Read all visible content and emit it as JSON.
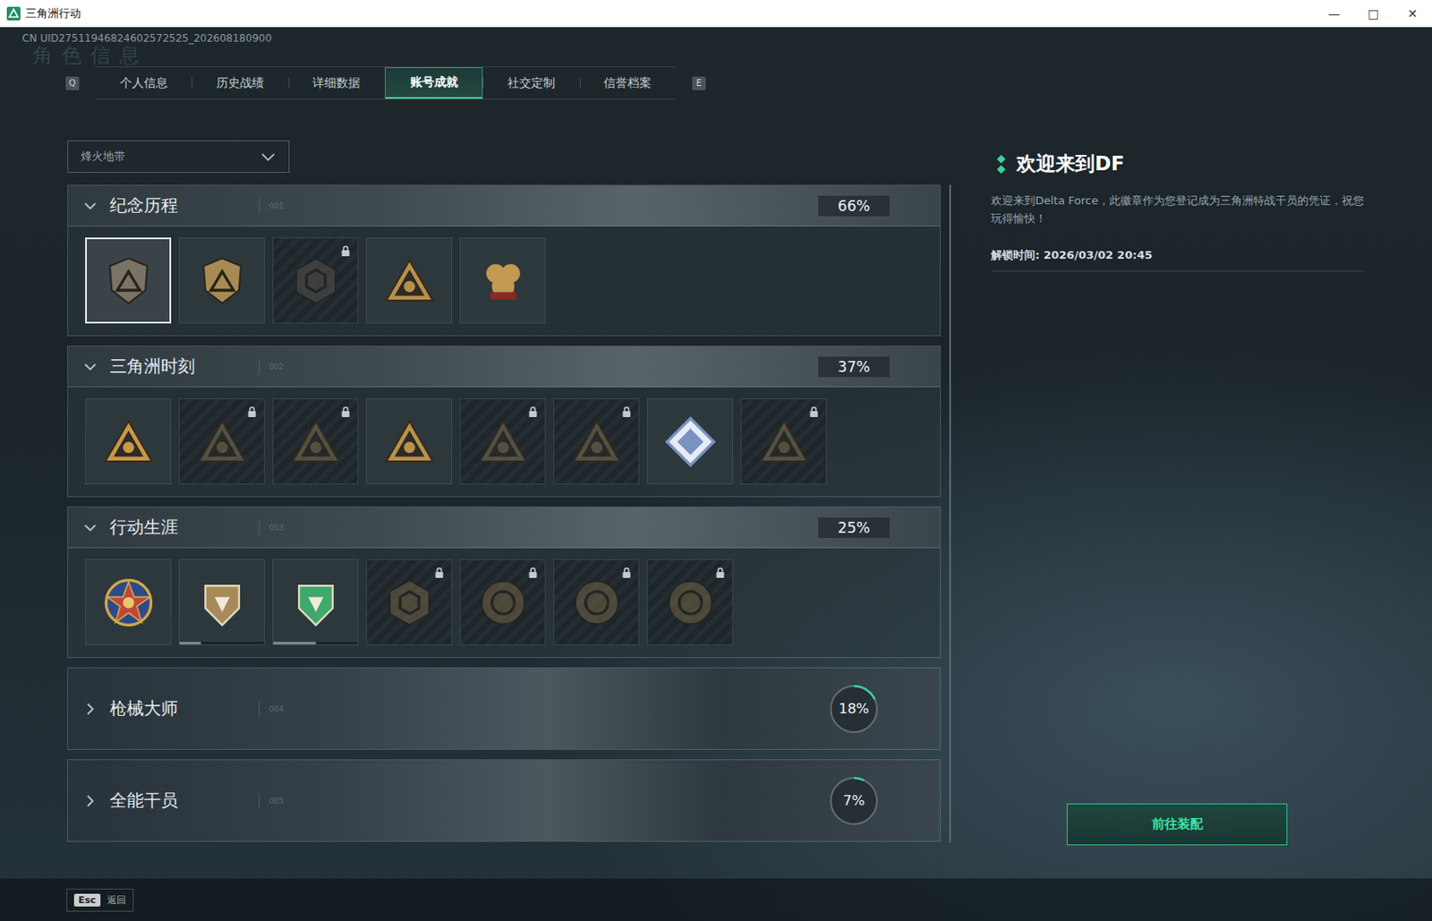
{
  "window": {
    "title": "三角洲行动",
    "controls": [
      "—",
      "□",
      "✕"
    ]
  },
  "uid": "CN UID27511946824602572525_202608180900",
  "watermark": "角色信息",
  "tabs": {
    "prevKey": "Q",
    "nextKey": "E",
    "items": [
      {
        "label": "个人信息",
        "selected": false
      },
      {
        "label": "历史战绩",
        "selected": false
      },
      {
        "label": "详细数据",
        "selected": false
      },
      {
        "label": "账号成就",
        "selected": true
      },
      {
        "label": "社交定制",
        "selected": false
      },
      {
        "label": "信誉档案",
        "selected": false
      }
    ]
  },
  "modeSelect": {
    "value": "烽火地带"
  },
  "categories": [
    {
      "index": "001",
      "title": "纪念历程",
      "progress": "66%",
      "expanded": true,
      "badges": [
        {
          "kind": "shield",
          "color": "#7a7466",
          "locked": false,
          "selected": true
        },
        {
          "kind": "shield",
          "color": "#a98a52",
          "locked": false,
          "selected": false
        },
        {
          "kind": "hexagon",
          "color": "#5a5650",
          "locked": true,
          "selected": false
        },
        {
          "kind": "triangle",
          "color": "#b8904e",
          "locked": false,
          "selected": false
        },
        {
          "kind": "cluster",
          "color": "#c29a52",
          "locked": false,
          "selected": false
        }
      ]
    },
    {
      "index": "002",
      "title": "三角洲时刻",
      "progress": "37%",
      "expanded": true,
      "badges": [
        {
          "kind": "triangle",
          "color": "#c79a4a",
          "locked": false,
          "selected": false
        },
        {
          "kind": "triangle",
          "color": "#8a7850",
          "locked": true,
          "selected": false
        },
        {
          "kind": "triangle",
          "color": "#8a7850",
          "locked": true,
          "selected": false
        },
        {
          "kind": "triangle",
          "color": "#b8924e",
          "locked": false,
          "selected": false
        },
        {
          "kind": "triangle",
          "color": "#8a7850",
          "locked": true,
          "selected": false
        },
        {
          "kind": "triangle",
          "color": "#8a7850",
          "locked": true,
          "selected": false
        },
        {
          "kind": "diamond",
          "color": "#7a92c0",
          "locked": false,
          "selected": false
        },
        {
          "kind": "triangle",
          "color": "#8a7850",
          "locked": true,
          "selected": false
        }
      ]
    },
    {
      "index": "003",
      "title": "行动生涯",
      "progress": "25%",
      "expanded": true,
      "badges": [
        {
          "kind": "star",
          "color": "#c0463a",
          "locked": false,
          "selected": false
        },
        {
          "kind": "crest",
          "color": "#a88a5a",
          "locked": false,
          "selected": false,
          "level": 0.25
        },
        {
          "kind": "crest",
          "color": "#3fa86a",
          "locked": false,
          "selected": false,
          "level": 0.5
        },
        {
          "kind": "hexagon",
          "color": "#7a6a48",
          "locked": true,
          "selected": false
        },
        {
          "kind": "round",
          "color": "#7a6a48",
          "locked": true,
          "selected": false
        },
        {
          "kind": "round",
          "color": "#7a6a48",
          "locked": true,
          "selected": false
        },
        {
          "kind": "round",
          "color": "#7a6a48",
          "locked": true,
          "selected": false
        }
      ]
    },
    {
      "index": "004",
      "title": "枪械大师",
      "progress": "18%",
      "expanded": false,
      "level": 0.18,
      "badges": []
    },
    {
      "index": "005",
      "title": "全能干员",
      "progress": "7%",
      "expanded": false,
      "level": 0.07,
      "badges": []
    }
  ],
  "detail": {
    "title": "欢迎来到DF",
    "description": "欢迎来到Delta Force，此徽章作为您登记成为三角洲特战干员的凭证，祝您玩得愉快！",
    "unlockTime": "解锁时间: 2026/03/02 20:45",
    "button": "前往装配"
  },
  "footer": {
    "key": "Esc",
    "label": "返回"
  }
}
